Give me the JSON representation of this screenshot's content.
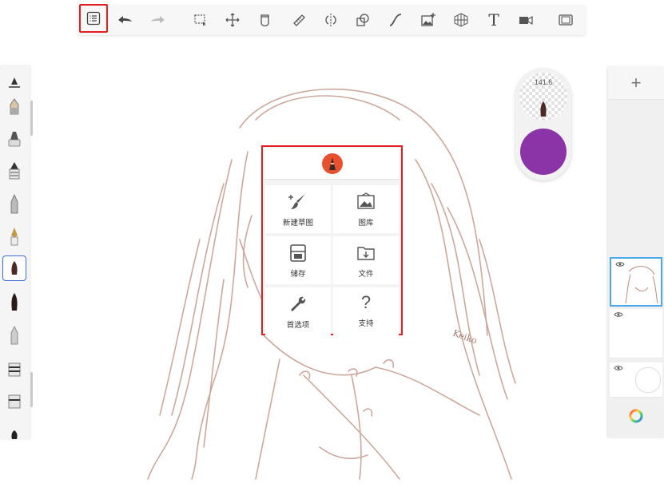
{
  "toolbar": {
    "items": [
      {
        "name": "menu",
        "icon": "list-icon"
      },
      {
        "name": "undo",
        "icon": "undo-arrow-icon"
      },
      {
        "name": "redo",
        "icon": "redo-arrow-icon"
      },
      {
        "name": "select",
        "icon": "marquee-select-icon"
      },
      {
        "name": "transform",
        "icon": "move-arrows-icon"
      },
      {
        "name": "fill",
        "icon": "paint-bucket-icon"
      },
      {
        "name": "ruler",
        "icon": "ruler-icon"
      },
      {
        "name": "symmetry",
        "icon": "symmetry-icon"
      },
      {
        "name": "shapes",
        "icon": "shapes-icon"
      },
      {
        "name": "curve",
        "icon": "curve-icon"
      },
      {
        "name": "import-image",
        "icon": "image-add-icon"
      },
      {
        "name": "perspective",
        "icon": "perspective-grid-icon"
      },
      {
        "name": "text",
        "icon": "text-icon",
        "label": "T"
      },
      {
        "name": "timelapse",
        "icon": "video-camera-icon"
      },
      {
        "name": "fullscreen",
        "icon": "fullscreen-icon"
      }
    ]
  },
  "puck": {
    "brush_size": "141.6",
    "color": "#8a34a8"
  },
  "menu": {
    "logo_icon": "app-logo-icon",
    "items": [
      {
        "label": "新建草图",
        "icon": "new-sketch-icon"
      },
      {
        "label": "图库",
        "icon": "gallery-icon"
      },
      {
        "label": "储存",
        "icon": "save-icon"
      },
      {
        "label": "文件",
        "icon": "folder-icon"
      },
      {
        "label": "首选项",
        "icon": "wrench-icon"
      },
      {
        "label": "支持",
        "icon": "question-icon",
        "glyph": "?"
      }
    ]
  },
  "layers": {
    "add_label": "+",
    "color_wheel_icon": "color-wheel-icon"
  },
  "canvas": {
    "signature": "Keiko"
  },
  "colors": {
    "accent_red": "#e02020",
    "sketch": "#b98a7e",
    "selection_blue": "#3a6fd8"
  }
}
